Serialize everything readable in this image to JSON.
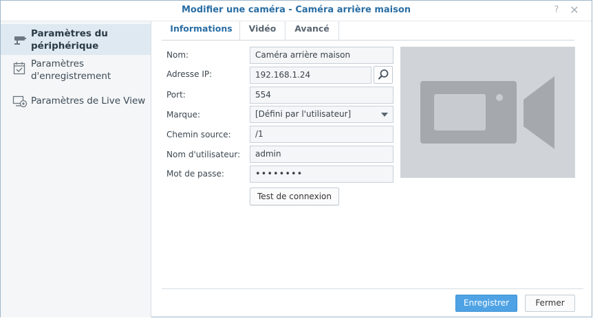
{
  "window": {
    "title": "Modifier une caméra - Caméra arrière maison",
    "help_icon": "?",
    "close_icon": "✕"
  },
  "sidebar": {
    "items": [
      {
        "label_line1": "Paramètres du",
        "label_line2": "périphérique",
        "icon": "camera-device-icon",
        "active": true
      },
      {
        "label_line1": "Paramètres",
        "label_line2": "d'enregistrement",
        "icon": "calendar-check-icon",
        "active": false
      },
      {
        "label_line1": "Paramètres de Live View",
        "label_line2": "",
        "icon": "monitor-camera-icon",
        "active": false
      }
    ]
  },
  "tabs": [
    {
      "label": "Informations",
      "active": true
    },
    {
      "label": "Vidéo",
      "active": false
    },
    {
      "label": "Avancé",
      "active": false
    }
  ],
  "form": {
    "name": {
      "label": "Nom:",
      "value": "Caméra arrière maison"
    },
    "ip": {
      "label": "Adresse IP:",
      "value": "192.168.1.24"
    },
    "port": {
      "label": "Port:",
      "value": "554"
    },
    "brand": {
      "label": "Marque:",
      "value": "[Défini par l'utilisateur]"
    },
    "source_path": {
      "label": "Chemin source:",
      "value": "/1"
    },
    "username": {
      "label": "Nom d'utilisateur:",
      "value": "admin"
    },
    "password": {
      "label": "Mot de passe:",
      "value": "••••••••"
    },
    "test_button": "Test de connexion"
  },
  "footer": {
    "save_label": "Enregistrer",
    "close_label": "Fermer"
  },
  "colors": {
    "accent": "#2a6ea3",
    "primary_button": "#4fa3e5",
    "sidebar_active": "#dfe9f1",
    "preview_bg": "#d0d4d8",
    "preview_icon": "#a5a9ad"
  }
}
